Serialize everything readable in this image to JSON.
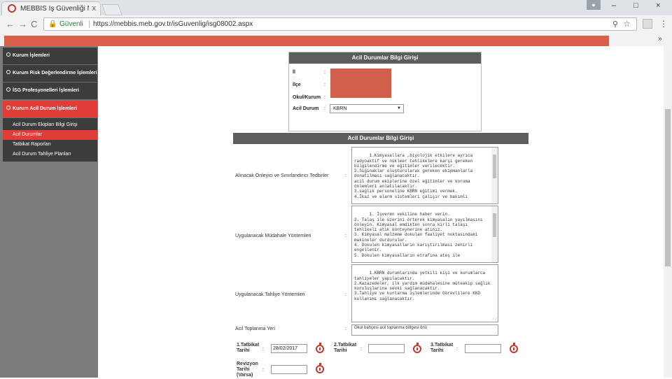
{
  "browser": {
    "tab_title": "MEBBIS İş Güvenliği Mod",
    "tab_close": "x",
    "secure_label": "Güvenli",
    "url": "https://mebbis.meb.gov.tr/isGuvenlig/isg08002.aspx",
    "win_minimize": "–",
    "win_maximize": "□",
    "win_close": "×",
    "back": "←",
    "forward": "→",
    "reload": "C",
    "bookmarks_more": "»"
  },
  "sidebar": {
    "items": [
      {
        "label": "Kurum İşlemleri"
      },
      {
        "label": "Kurum Risk Değerlendirme İşlemleri"
      },
      {
        "label": "İSG Profesyonelleri İşlemleri"
      },
      {
        "label": "Kurum Acil Durum İşlemleri"
      }
    ],
    "subitems": [
      {
        "label": "Acil Durum Ekipları Bilgi Girişi"
      },
      {
        "label": "Acil Durumlar"
      },
      {
        "label": "Tatbikat Raporları"
      },
      {
        "label": "Acil Durum Tahliye Planları"
      }
    ]
  },
  "form1": {
    "header": "Acil Durumlar Bilgi Girişi",
    "il_label": "İl",
    "ilce_label": "İlçe",
    "okul_label": "Okul/Kurum",
    "acil_label": "Acil Durum",
    "colon": ":",
    "acil_value": "KBRN"
  },
  "form2": {
    "header": "Acil Durumlar Bilgi Girişi",
    "colon": ":",
    "row1_label": "Alınacak Önleyici ve Sınırlandırıcı Tedbirler",
    "row1_text": "1.Kimyasallara ,biyolojik etkilere ayrıca radyoaktif ve nükleer tehlikelere karşı gereken bilgilendirme ve eğitimler verilecektir.\n2.Sığınaklar oluşturularak gereken ekipmanlarla donatılması sağlanacaktır.\nacil durum ekiplerine özel eğitimler ve koruma önlemleri anlatılacaktır.\n3.sağlık personeline KBRN eğitimi vermek.\n4.İkaz ve alarm sistemleri çalışır ve bakımlı",
    "row2_label": "Uygulanacak Müdahale Yöntemleri",
    "row2_text": "1. İşveren vekiline haber verin.\n2. Talaş ile üzerini örterek kimyasalın yayılmasını önleyin. Kimyasal emdikten sonra kirli talaşı tehlikeli atık konteynerine atınız.\n3. Kimyasal malzeme dokulan faaliyet noktasındaki makineler durdurulur.\n4. Dokulen kimyasalların karıştırılması zehirli engellenir.\n5. Dokulen kimyasalların etrafına ateş ile",
    "row3_label": "Uygulanacak Tahliye Yöntemleri",
    "row3_text": "1.KBRN durumlarında yetkili kişi ve kurumlarca tahliyeler yapılacaktır.\n2.Kazazedeler, ilk yardım müdahalesine müteakip sağlık kuruluşlarına sevki sağlanacaktır.\n3.Tahliye ve kurtarma işlemlerinde Görevlilere KKD kullanımı sağlanacaktır.",
    "row4_label": "Acil Toplanma Yeri",
    "row4_text": "Okul bahçesi acil toplanma bölgesi önü",
    "date1_label": "1.Tatbikat Tarihi",
    "date1_value": "28/02/2017",
    "date2_label": "2.Tatbikat Tarihi",
    "date2_value": "",
    "date3_label": "3.Tatbikat Tarihi",
    "date3_value": "",
    "date4_label": "Revizyon Tarihi (Varsa)",
    "date4_value": ""
  },
  "colors": {
    "accent": "#e03c38",
    "banner": "#d9604b",
    "header": "#5d5d5d",
    "sidebar": "#3c3c3c"
  }
}
